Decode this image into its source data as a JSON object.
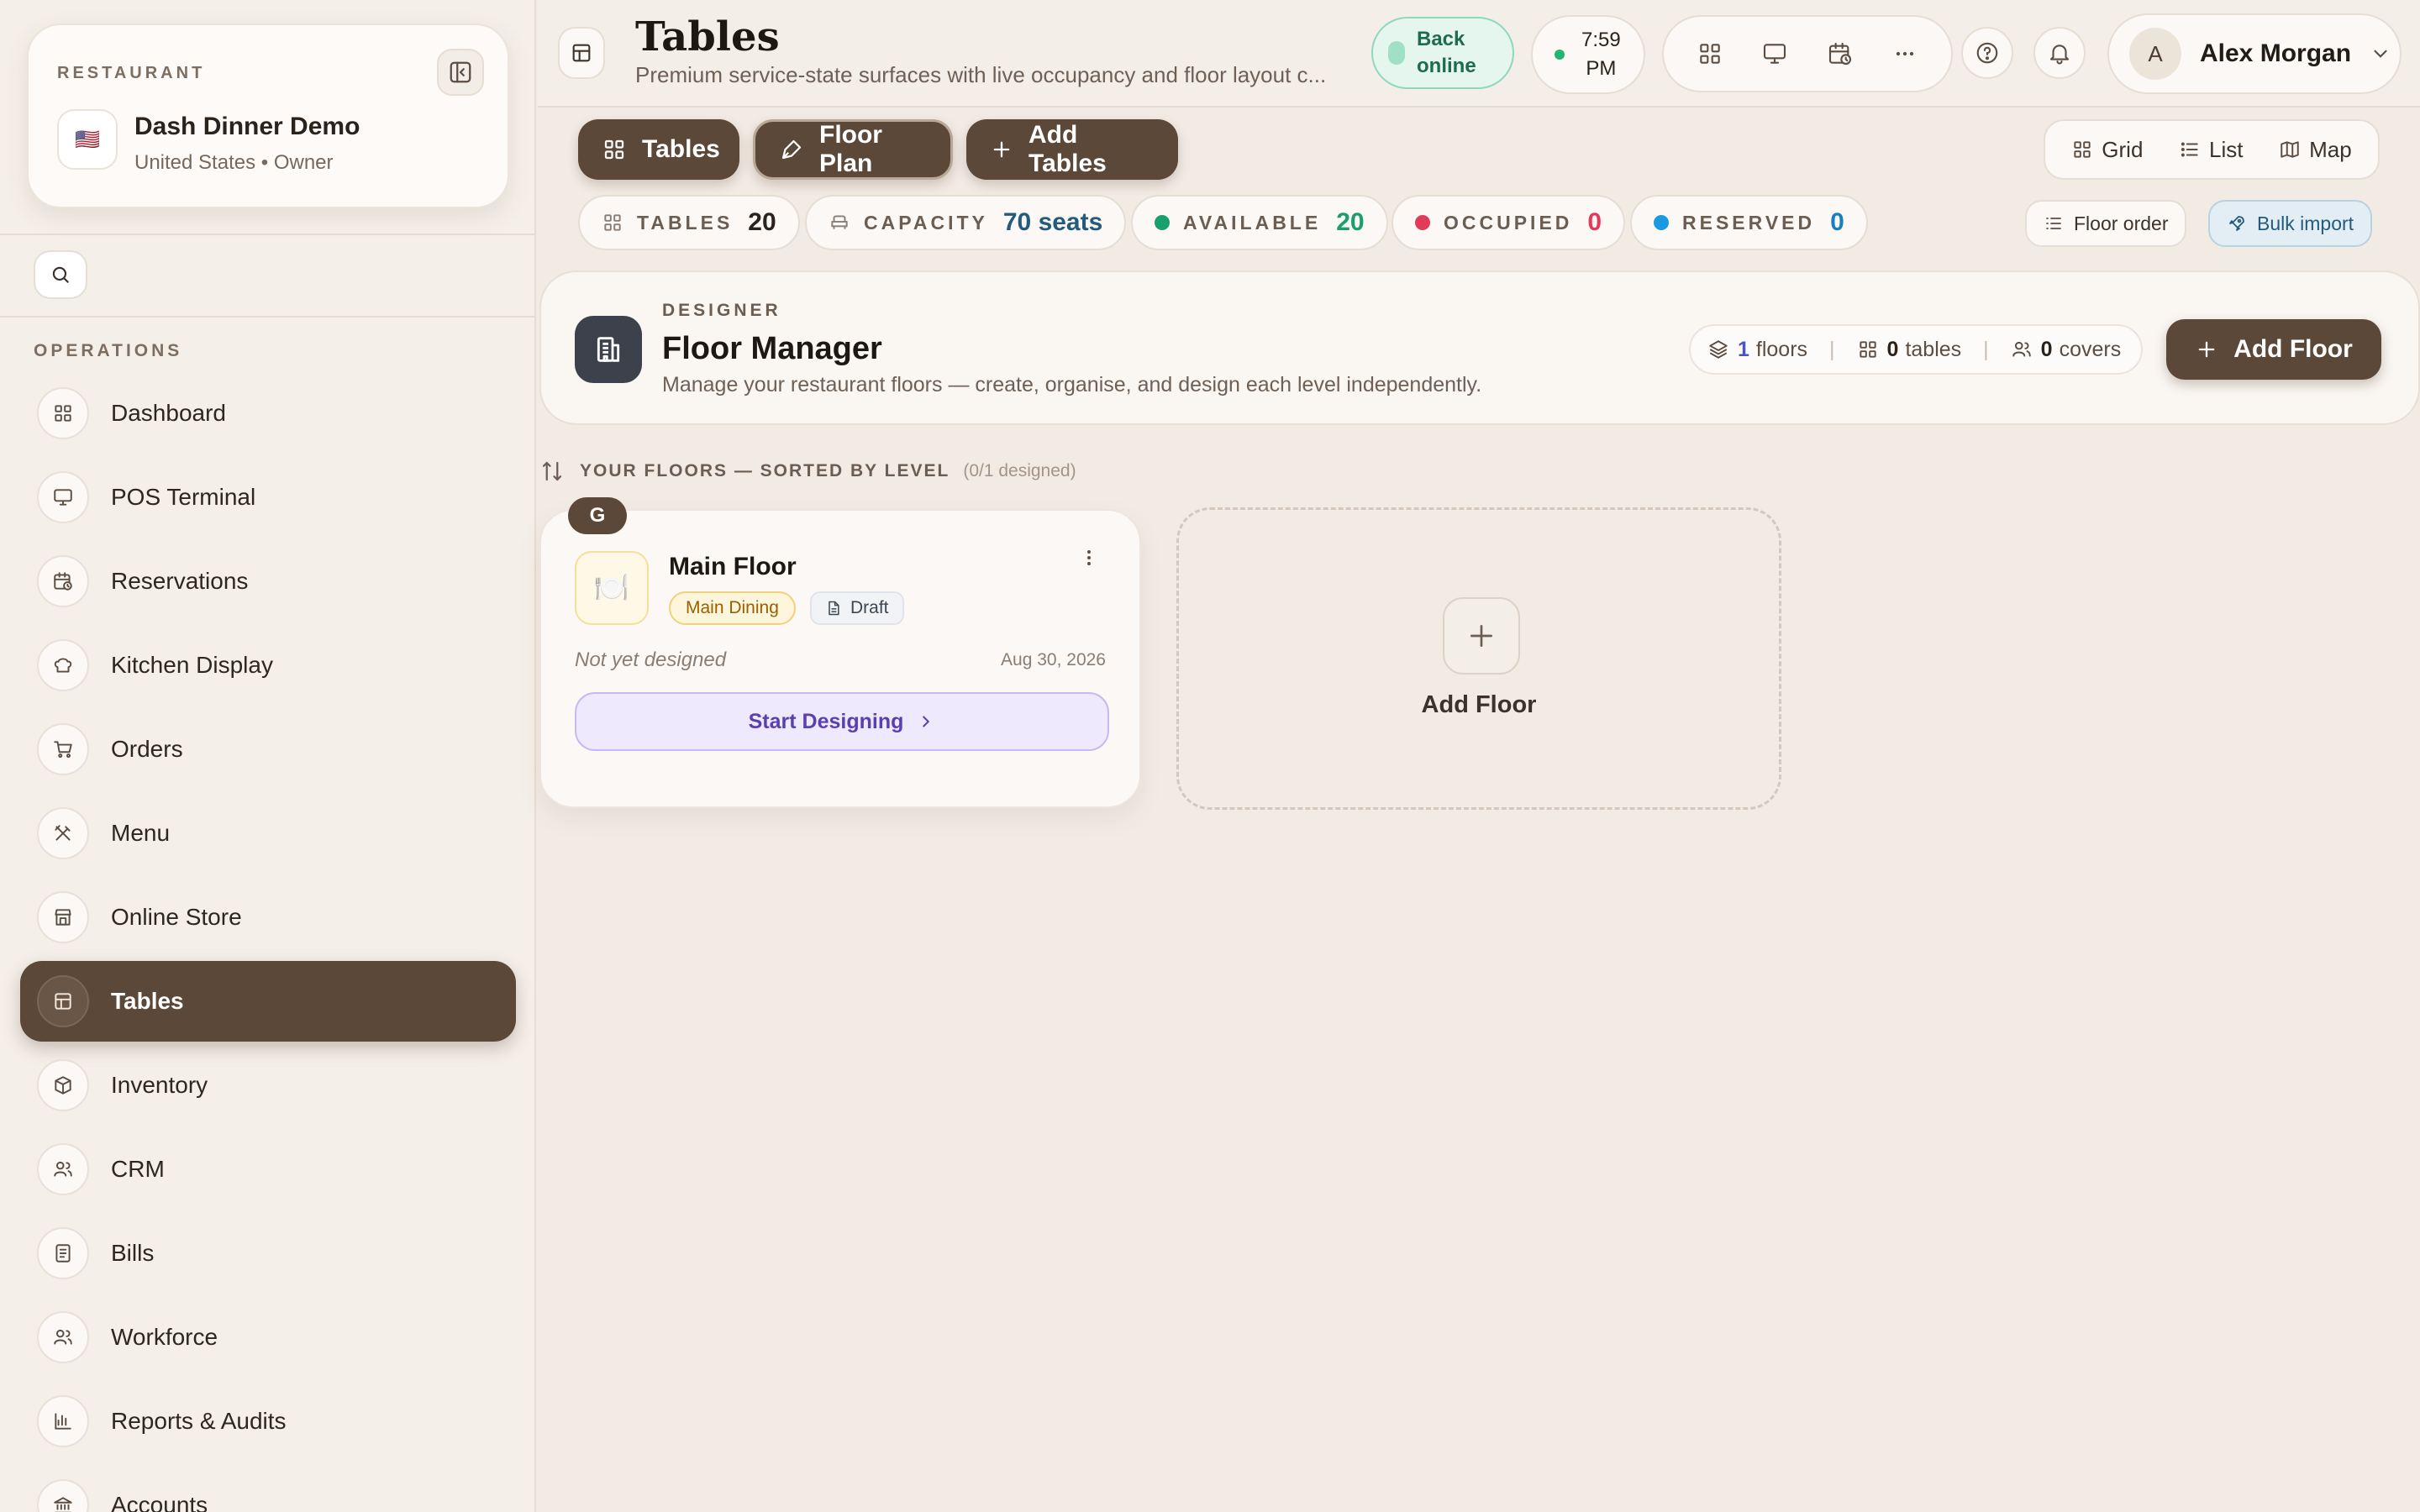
{
  "sidebar": {
    "restaurant_label": "RESTAURANT",
    "flag": "🇺🇸",
    "restaurant_name": "Dash Dinner Demo",
    "restaurant_sub": "United States • Owner",
    "section_label": "OPERATIONS",
    "items": [
      {
        "label": "Dashboard",
        "icon": "grid-icon"
      },
      {
        "label": "POS Terminal",
        "icon": "monitor-icon"
      },
      {
        "label": "Reservations",
        "icon": "calendar-clock-icon"
      },
      {
        "label": "Kitchen Display",
        "icon": "chef-hat-icon"
      },
      {
        "label": "Orders",
        "icon": "cart-icon"
      },
      {
        "label": "Menu",
        "icon": "utensils-icon"
      },
      {
        "label": "Online Store",
        "icon": "store-icon"
      },
      {
        "label": "Tables",
        "icon": "table-icon",
        "active": true
      },
      {
        "label": "Inventory",
        "icon": "box-icon"
      },
      {
        "label": "CRM",
        "icon": "users-icon"
      },
      {
        "label": "Bills",
        "icon": "receipt-icon"
      },
      {
        "label": "Workforce",
        "icon": "team-icon"
      },
      {
        "label": "Reports & Audits",
        "icon": "bar-chart-icon"
      },
      {
        "label": "Accounts",
        "icon": "bank-icon"
      }
    ]
  },
  "header": {
    "title": "Tables",
    "subtitle": "Premium service-state surfaces with live occupancy and floor layout c...",
    "status": "Back online",
    "time_line1": "7:59",
    "time_line2": "PM",
    "user_initial": "A",
    "user_name": "Alex Morgan"
  },
  "tabs": {
    "tables": "Tables",
    "floor_plan": "Floor Plan",
    "add_tables": "Add Tables"
  },
  "views": {
    "grid": "Grid",
    "list": "List",
    "map": "Map"
  },
  "stats": {
    "tables_label": "TABLES",
    "tables_value": "20",
    "capacity_label": "CAPACITY",
    "capacity_value": "70 seats",
    "available_label": "AVAILABLE",
    "available_value": "20",
    "occupied_label": "OCCUPIED",
    "occupied_value": "0",
    "reserved_label": "RESERVED",
    "reserved_value": "0"
  },
  "actions": {
    "floor_order": "Floor order",
    "bulk_import": "Bulk import"
  },
  "designer": {
    "kicker": "DESIGNER",
    "title": "Floor Manager",
    "description": "Manage your restaurant floors — create, organise, and design each level independently.",
    "floors_count": "1",
    "floors_label": "floors",
    "tables_count": "0",
    "tables_label": "tables",
    "covers_count": "0",
    "covers_label": "covers",
    "add_floor": "Add Floor"
  },
  "floors_section": {
    "title": "YOUR FLOORS — SORTED BY LEVEL",
    "designed_count": "(0/1 designed)"
  },
  "floor": {
    "level": "G",
    "thumb": "🍽️",
    "name": "Main Floor",
    "tag": "Main Dining",
    "state": "Draft",
    "status_text": "Not yet designed",
    "date": "Aug 30, 2026",
    "cta": "Start Designing"
  },
  "add_floor_card": {
    "label": "Add Floor"
  },
  "colors": {
    "brand": "#5b4838",
    "available": "#1a9e6e",
    "occupied": "#e23b5a",
    "reserved": "#1b9ae0",
    "capacity": "#245b7c"
  }
}
